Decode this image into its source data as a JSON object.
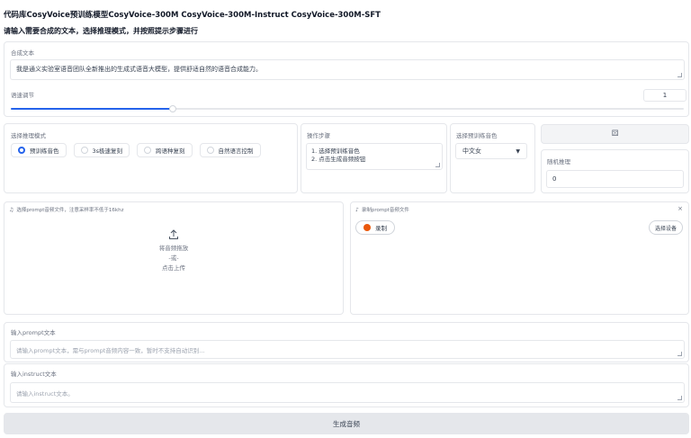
{
  "header": {
    "title": "代码库CosyVoice预训练模型CosyVoice-300M CosyVoice-300M-Instruct CosyVoice-300M-SFT",
    "subtitle": "请输入需要合成的文本，选择推理模式，并按照提示步骤进行"
  },
  "synth_text": {
    "label": "合成文本",
    "value": "我是通义实验室语音团队全新推出的生成式语音大模型，提供舒适自然的语音合成能力。"
  },
  "speed": {
    "label": "语速调节",
    "value": "1",
    "level_fraction": 0.24
  },
  "mode": {
    "label": "选择推理模式",
    "options": [
      "预训练音色",
      "3s极速复刻",
      "跨语种复刻",
      "自然语言控制"
    ],
    "selected_index": 0
  },
  "steps": {
    "label": "操作步骤",
    "lines": [
      "1. 选择预训练音色",
      "2. 点击生成音频按钮"
    ]
  },
  "speaker": {
    "label": "选择预训练音色",
    "value": "中文女"
  },
  "seed": {
    "button_icon": "dice-icon",
    "label": "随机推理",
    "value": "0"
  },
  "prompt_upload": {
    "label": "选择prompt音频文件，注意采样率不低于16khz",
    "line1": "将音频拖放",
    "line2": "-或-",
    "line3": "点击上传"
  },
  "prompt_record": {
    "label": "录制prompt音频文件",
    "record_button": "录制",
    "device_button": "选择设备"
  },
  "prompt_text": {
    "label": "输入prompt文本",
    "placeholder": "请输入prompt文本，需与prompt音频内容一致，暂时不支持自动识别..."
  },
  "instruct_text": {
    "label": "输入instruct文本",
    "placeholder": "请输入instruct文本。"
  },
  "generate": {
    "label": "生成音频"
  },
  "colors": {
    "accent": "#2563eb",
    "record": "#ea580c",
    "panel_border": "#e5e7eb",
    "button_bg": "#f3f4f6"
  }
}
